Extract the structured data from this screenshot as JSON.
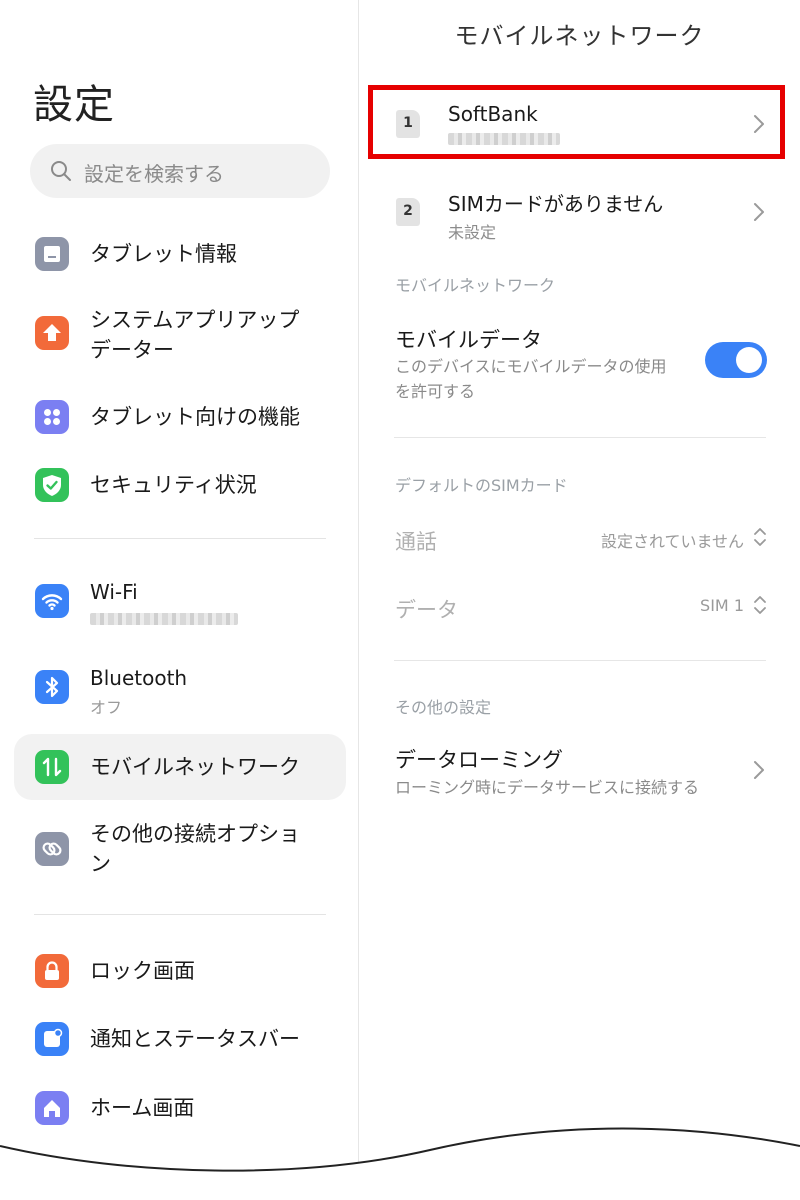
{
  "left": {
    "title": "設定",
    "search_placeholder": "設定を検索する",
    "items": [
      {
        "label": "タブレット情報",
        "icon": "tablet-icon",
        "color": "#8e95a8"
      },
      {
        "label": "システムアプリアップ",
        "label2": "データー",
        "icon": "upgrade-arrow-icon",
        "color": "#f26a3a"
      },
      {
        "label": "タブレット向けの機能",
        "icon": "features-grid-icon",
        "color": "#7b7ff2"
      },
      {
        "label": "セキュリティ状況",
        "icon": "shield-check-icon",
        "color": "#33c25a"
      },
      {
        "label": "Wi-Fi",
        "icon": "wifi-icon",
        "color": "#3a82f7"
      },
      {
        "label": "Bluetooth",
        "sub": "オフ",
        "icon": "bluetooth-icon",
        "color": "#3a82f7"
      },
      {
        "label": "モバイルネットワーク",
        "icon": "mobile-network-icon",
        "color": "#33c25a"
      },
      {
        "label": "その他の接続オプショ",
        "label2": "ン",
        "icon": "link-icon",
        "color": "#8e95a8"
      },
      {
        "label": "ロック画面",
        "icon": "lock-icon",
        "color": "#f26a3a"
      },
      {
        "label": "通知とステータスバー",
        "icon": "notification-icon",
        "color": "#3a82f7"
      },
      {
        "label": "ホーム画面",
        "icon": "home-icon",
        "color": "#7b7ff2"
      }
    ]
  },
  "right": {
    "title": "モバイルネットワーク",
    "sims": [
      {
        "slot": "1",
        "name": "SoftBank"
      },
      {
        "slot": "2",
        "name": "SIMカードがありません",
        "sub": "未設定"
      }
    ],
    "section_mobile": "モバイルネットワーク",
    "mobile_data": {
      "title": "モバイルデータ",
      "desc1": "このデバイスにモバイルデータの使用",
      "desc2": "を許可する",
      "enabled": true
    },
    "section_default_sim": "デフォルトのSIMカード",
    "call": {
      "label": "通話",
      "value": "設定されていません"
    },
    "data": {
      "label": "データ",
      "value": "SIM 1"
    },
    "section_other": "その他の設定",
    "roaming": {
      "title": "データローミング",
      "sub": "ローミング時にデータサービスに接続する"
    }
  },
  "colors": {
    "accent": "#3a82f7",
    "highlight": "#e60000"
  }
}
